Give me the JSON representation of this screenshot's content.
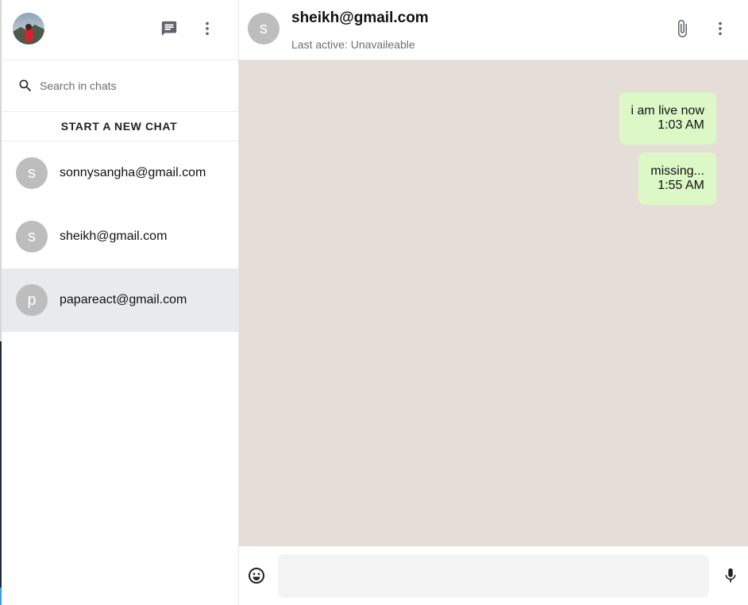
{
  "sidebar": {
    "avatar_icon": "user-avatar-photo",
    "new_message_icon": "chat-bubble-icon",
    "menu_icon": "vertical-dots-icon",
    "search": {
      "icon": "search-icon",
      "placeholder": "Search in chats",
      "value": ""
    },
    "new_chat_label": "START A NEW CHAT",
    "chats": [
      {
        "initial": "s",
        "email": "sonnysangha@gmail.com",
        "active": false
      },
      {
        "initial": "s",
        "email": "sheikh@gmail.com",
        "active": false
      },
      {
        "initial": "p",
        "email": "papareact@gmail.com",
        "active": true
      }
    ]
  },
  "chat": {
    "header": {
      "initial": "s",
      "title": "sheikh@gmail.com",
      "status": "Last active: Unavaileable",
      "attach_icon": "paperclip-icon",
      "menu_icon": "vertical-dots-icon"
    },
    "messages": [
      {
        "text": "i am live now",
        "time": "1:03 AM"
      },
      {
        "text": "missing...",
        "time": "1:55 AM"
      }
    ],
    "composer": {
      "emoji_icon": "emoji-icon",
      "input_value": "",
      "input_placeholder": "",
      "mic_icon": "microphone-icon"
    }
  },
  "colors": {
    "chat_background": "#e5ded8",
    "bubble": "#dcf8c6",
    "avatar_gray": "#bdbdbd",
    "active_row": "#e9eaeb"
  }
}
